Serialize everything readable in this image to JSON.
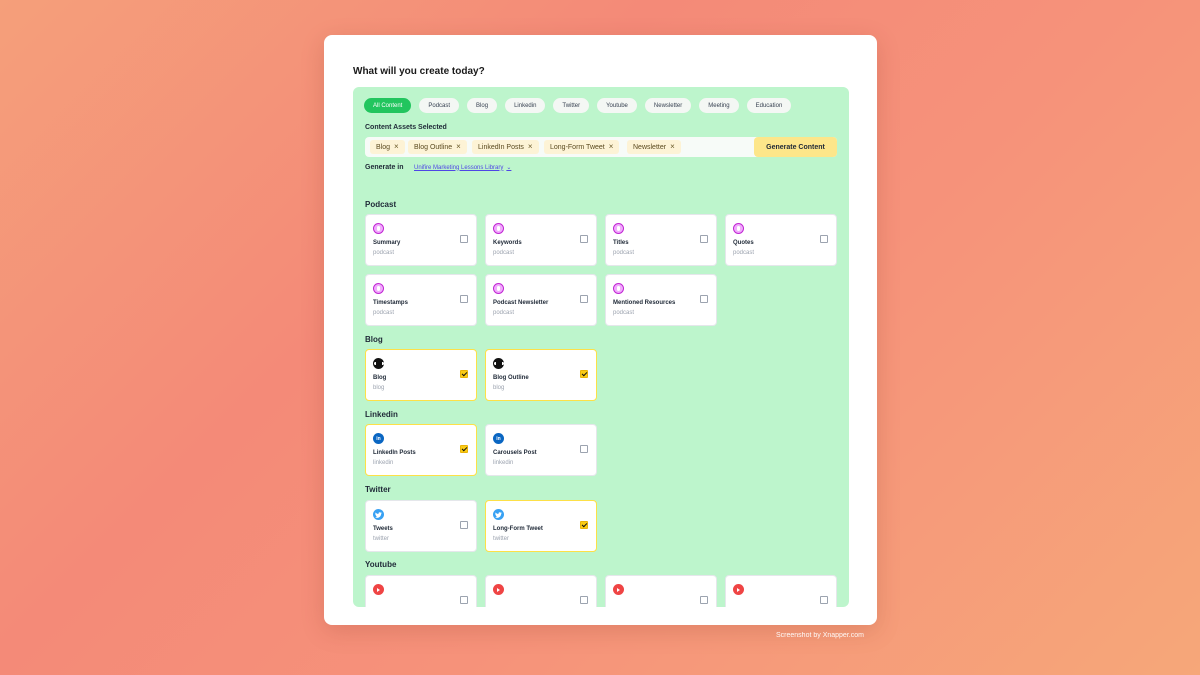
{
  "heading": "What will you create today?",
  "filters": [
    "All Content",
    "Podcast",
    "Blog",
    "Linkedin",
    "Twitter",
    "Youtube",
    "Newsletter",
    "Meeting",
    "Education"
  ],
  "active_filter": "All Content",
  "assets_label": "Content Assets Selected",
  "selected_assets": [
    "Blog",
    "Blog Outline",
    "LinkedIn Posts",
    "Long-Form Tweet",
    "Newsletter"
  ],
  "remove_glyph": "×",
  "generate_button": "Generate Content",
  "generate_in_label": "Generate in",
  "library": "Unifire Marketing Lessons Library",
  "sections": {
    "podcast": {
      "title": "Podcast",
      "items": [
        {
          "title": "Summary",
          "sub": "podcast",
          "checked": false
        },
        {
          "title": "Keywords",
          "sub": "podcast",
          "checked": false
        },
        {
          "title": "Titles",
          "sub": "podcast",
          "checked": false
        },
        {
          "title": "Quotes",
          "sub": "podcast",
          "checked": false
        },
        {
          "title": "Timestamps",
          "sub": "podcast",
          "checked": false
        },
        {
          "title": "Podcast Newsletter",
          "sub": "podcast",
          "checked": false
        },
        {
          "title": "Mentioned Resources",
          "sub": "podcast",
          "checked": false
        }
      ]
    },
    "blog": {
      "title": "Blog",
      "items": [
        {
          "title": "Blog",
          "sub": "blog",
          "checked": true
        },
        {
          "title": "Blog Outline",
          "sub": "blog",
          "checked": true
        }
      ]
    },
    "linkedin": {
      "title": "Linkedin",
      "items": [
        {
          "title": "LinkedIn Posts",
          "sub": "linkedin",
          "checked": true
        },
        {
          "title": "Carousels Post",
          "sub": "linkedin",
          "checked": false
        }
      ]
    },
    "twitter": {
      "title": "Twitter",
      "items": [
        {
          "title": "Tweets",
          "sub": "twitter",
          "checked": false
        },
        {
          "title": "Long-Form Tweet",
          "sub": "twitter",
          "checked": true
        }
      ]
    },
    "youtube": {
      "title": "Youtube",
      "items": [
        {
          "title": "",
          "sub": "",
          "checked": false
        },
        {
          "title": "",
          "sub": "",
          "checked": false
        },
        {
          "title": "",
          "sub": "",
          "checked": false
        },
        {
          "title": "",
          "sub": "",
          "checked": false
        }
      ]
    }
  },
  "icons": {
    "podcast": "podcast-icon",
    "blog": "medium-icon",
    "linkedin": "linkedin-icon",
    "twitter": "twitter-icon",
    "youtube": "youtube-icon",
    "linkedin_glyph": "in",
    "dropdown": "chevron-down-icon"
  },
  "colors": {
    "panel": "#bdf5cc",
    "active_chip": "#22c55e",
    "generate_button": "#fde68a",
    "checked": "#facc15"
  },
  "watermark": "Screenshot by Xnapper.com"
}
